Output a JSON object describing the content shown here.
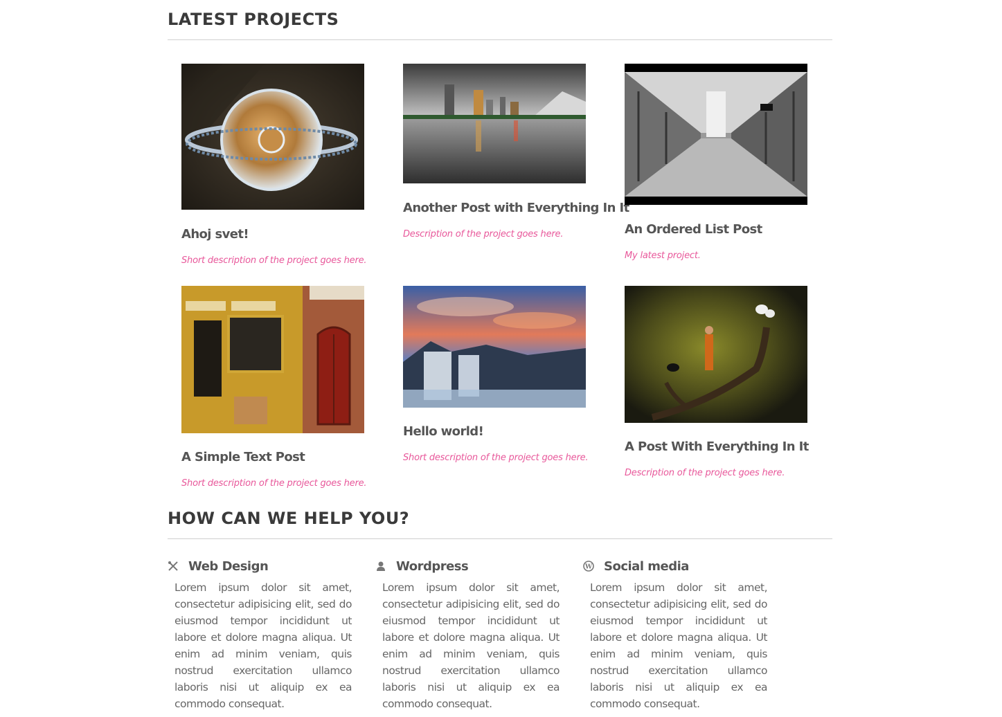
{
  "sections": {
    "projects_title": "LATEST PROJECTS",
    "help_title": "HOW CAN WE HELP YOU?"
  },
  "projects": [
    {
      "title": "Ahoj svet!",
      "description": "Short description of the project goes here.",
      "image": "glass-ornament-photo"
    },
    {
      "title": "Another Post with Everything In It",
      "description": "Description of the project goes here.",
      "image": "city-lake-reflection-photo"
    },
    {
      "title": "An Ordered List Post",
      "description": "My latest project.",
      "image": "arcade-gallery-photo"
    },
    {
      "title": "A Simple Text Post",
      "description": "Short description of the project goes here.",
      "image": "restaurant-storefront-photo"
    },
    {
      "title": "Hello world!",
      "description": "Short description of the project goes here.",
      "image": "waterfall-sunset-photo"
    },
    {
      "title": "A Post With Everything In It",
      "description": "Description of the project goes here.",
      "image": "monk-on-branch-photo"
    }
  ],
  "services": [
    {
      "title": "Web Design",
      "icon": "tools-icon",
      "text": "Lorem ipsum dolor sit amet, consectetur adipisicing elit, sed do eiusmod tempor incididunt ut labore et dolore magna aliqua. Ut enim ad minim veniam, quis nostrud exercitation ullamco laboris nisi ut aliquip ex ea commodo consequat."
    },
    {
      "title": "Wordpress",
      "icon": "user-icon",
      "text": "Lorem ipsum dolor sit amet, consectetur adipisicing elit, sed do eiusmod tempor incididunt ut labore et dolore magna aliqua. Ut enim ad minim veniam, quis nostrud exercitation ullamco laboris nisi ut aliquip ex ea commodo consequat."
    },
    {
      "title": "Social media",
      "icon": "wordpress-icon",
      "text": "Lorem ipsum dolor sit amet, consectetur adipisicing elit, sed do eiusmod tempor incididunt ut labore et dolore magna aliqua. Ut enim ad minim veniam, quis nostrud exercitation ullamco laboris nisi ut aliquip ex ea commodo consequat."
    }
  ],
  "colors": {
    "accent": "#e8579a",
    "heading": "#3a3a3a",
    "text": "#666666",
    "rule": "#cfcfcf"
  }
}
